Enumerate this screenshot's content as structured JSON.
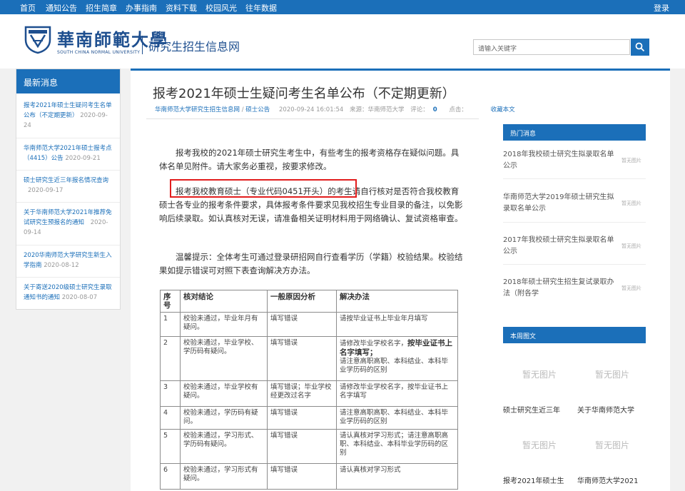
{
  "topnav": {
    "items": [
      "首页",
      "通知公告",
      "招生简章",
      "办事指南",
      "资料下载",
      "校园风光",
      "往年数据"
    ],
    "login": "登录"
  },
  "header": {
    "logo_cn": "華南師範大學",
    "logo_en": "SOUTH CHINA NORMAL UNIVERSITY",
    "site_name": "研究生招生信息网",
    "search_placeholder": "请输入关键字"
  },
  "left": {
    "heading": "最新消息",
    "items": [
      {
        "title": "报考2021年硕士生疑问考生名单公布（不定期更新）",
        "date": "2020-09-24"
      },
      {
        "title": "华南师范大学2021年硕士报考点（4415）公告",
        "date": "2020-09-21"
      },
      {
        "title": "硕士研究生近三年报名情况查询",
        "date": "2020-09-17"
      },
      {
        "title": "关于华南师范大学2021年推荐免试研究生预报名的通知",
        "date": "2020-09-14"
      },
      {
        "title": "2020华南师范大学研究生新生入学指南",
        "date": "2020-08-12"
      },
      {
        "title": "关于寄送2020级硕士研究生录取通知书的通知",
        "date": "2020-08-07"
      }
    ]
  },
  "article": {
    "title": "报考2021年硕士生疑问考生名单公布（不定期更新）",
    "meta": {
      "source_site": "华南师范大学研究生招生信息网",
      "slash": " / ",
      "category": "硕士公告",
      "datetime": "2020-09-24 16:01:54",
      "source": "来源：华南师范大学",
      "comments_label": "评论：",
      "comments": "0",
      "clicks_label": "点击：",
      "favorite": "收藏本文"
    },
    "p1": "报考我校的2021年硕士研究生考生中，有些考生的报考资格存在疑似问题。具体名单见附件。请大家务必重视，按要求修改。",
    "p2": "报考我校教育硕士（专业代码0451开头）的考生请自行核对是否符合我校教育硕士各专业的报考条件要求，具体报考条件要求见我校招生专业目录的备注，以免影响后续录取。如认真核对无误，请准备相关证明材料用于网络确认、复试资格审查。",
    "p3": "温馨提示：全体考生可通过登录研招网自行查看学历（学籍）校验结果。校验结果如提示错误可对照下表查询解决方办法。",
    "table": {
      "headers": [
        "序号",
        "核对结论",
        "一般原因分析",
        "解决办法"
      ],
      "rows": [
        {
          "no": "1",
          "result": "校验未通过，毕业年月有疑问。",
          "reason": "填写错误",
          "solution": "请按毕业证书上毕业年月填写",
          "solution_big": ""
        },
        {
          "no": "2",
          "result": "校验未通过，毕业学校、学历码有疑问。",
          "reason": "填写错误",
          "solution": "请修改毕业学校名字，",
          "solution_big": "按毕业证书上名字填写；",
          "solution_rest": "请注意高职高职、本科结业、本科毕业学历码的区别"
        },
        {
          "no": "3",
          "result": "校验未通过，毕业学校有疑问。",
          "reason": "填写错误；毕业学校经更改过名字",
          "solution": "请修改毕业学校名字，按毕业证书上名字填写",
          "solution_big": ""
        },
        {
          "no": "4",
          "result": "校验未通过，学历码有疑问。",
          "reason": "填写错误",
          "solution": "请注意高职高职、本科结业、本科毕业学历码的区别",
          "solution_big": ""
        },
        {
          "no": "5",
          "result": "校验未通过，学习形式、学历码有疑问。",
          "reason": "填写错误",
          "solution": "请认真核对学习形式；请注意高职高职、本科结业、本科毕业学历码的区别",
          "solution_big": ""
        },
        {
          "no": "6",
          "result": "校验未通过，学习形式有疑问。",
          "reason": "填写错误",
          "solution": "请认真核对学习形式",
          "solution_big": ""
        }
      ]
    }
  },
  "right": {
    "hot_heading": "热门消息",
    "hot_items": [
      {
        "title": "2018年我校硕士研究生拟录取名单公示",
        "img": "暂无图片"
      },
      {
        "title": "华南师范大学2019年硕士研究生拟录取名单公示",
        "img": "暂无图片"
      },
      {
        "title": "2017年我校硕士研究生拟录取名单公示",
        "img": "暂无图片"
      },
      {
        "title": "2018年硕士研究生招生复试录取办法（附各学",
        "img": "暂无图片"
      }
    ],
    "photo_heading": "本周图文",
    "photos": [
      {
        "img": "暂无图片",
        "caption": "硕士研究生近三年"
      },
      {
        "img": "暂无图片",
        "caption": "关于华南师范大学"
      },
      {
        "img": "暂无图片",
        "caption": "报考2021年硕士生"
      },
      {
        "img": "暂无图片",
        "caption": "华南师范大学2021"
      }
    ]
  },
  "colors": {
    "primary": "#1b6fb9",
    "highlight_box": "#e21d1d",
    "date": "#999999"
  }
}
